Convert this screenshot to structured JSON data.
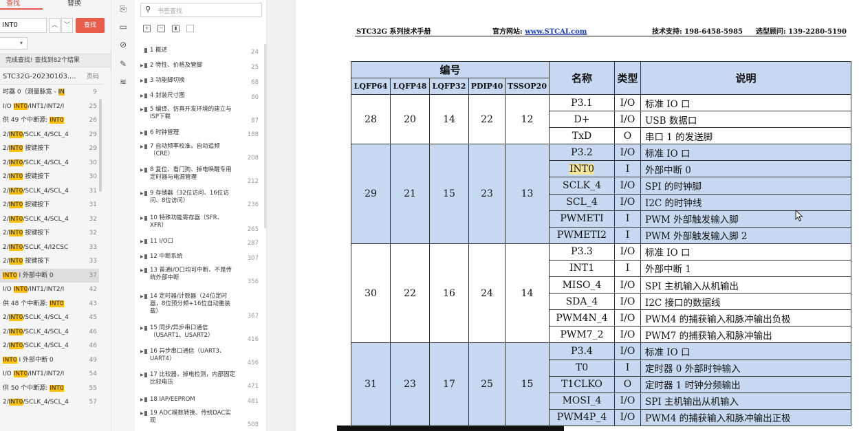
{
  "search_panel": {
    "tabs": [
      "查找",
      "替换"
    ],
    "query": "INT0",
    "find_button": "查找",
    "status": "完成查找! 查找到82个结果",
    "header_title": "STC32G-20230103....",
    "header_page": "页码",
    "results": [
      {
        "pre": "时器 0（测量脉宽 - ",
        "hit": "IN",
        "post": "",
        "page": "9"
      },
      {
        "pre": "I/O ",
        "hit": "INT0",
        "post": "/INT1/INT2/I",
        "page": "25"
      },
      {
        "pre": "供 49 个中断源: ",
        "hit": "INT0",
        "post": "",
        "page": "26"
      },
      {
        "pre": "2/",
        "hit": "INT0",
        "post": "/SCLK_4/SCL_4",
        "page": "29"
      },
      {
        "pre": "2/",
        "hit": "INT0",
        "post": " 按键按下",
        "page": "29"
      },
      {
        "pre": "2/",
        "hit": "INT0",
        "post": "/SCLK_4/SCL_4",
        "page": "30"
      },
      {
        "pre": "2/",
        "hit": "INT0",
        "post": " 按键按下",
        "page": "30"
      },
      {
        "pre": "2/",
        "hit": "INT0",
        "post": "/SCLK_4/SCL_4",
        "page": "31"
      },
      {
        "pre": "2/",
        "hit": "INT0",
        "post": " 按键按下",
        "page": "31"
      },
      {
        "pre": "2/",
        "hit": "INT0",
        "post": "/SCLK_4/SCL_4",
        "page": "32"
      },
      {
        "pre": "2/",
        "hit": "INT0",
        "post": " 按键按下",
        "page": "32"
      },
      {
        "pre": "2/",
        "hit": "INT0",
        "post": "/SCLK_4/I2CSC",
        "page": "33"
      },
      {
        "pre": "2/",
        "hit": "INT0",
        "post": " 按键按下",
        "page": "33"
      },
      {
        "pre": "",
        "hit": "INT0",
        "post": " I 外部中断 0",
        "page": "37"
      },
      {
        "pre": "I/O ",
        "hit": "INT0",
        "post": "/INT1/INT2/I",
        "page": "42"
      },
      {
        "pre": "供 48 个中断源: ",
        "hit": "INT0",
        "post": "",
        "page": "43"
      },
      {
        "pre": "2/",
        "hit": "INT0",
        "post": "/SCLK_4/SCL_4",
        "page": "45"
      },
      {
        "pre": "2/",
        "hit": "INT0",
        "post": "/SCLK_4/SCL_4",
        "page": "46"
      },
      {
        "pre": "2/",
        "hit": "INT0",
        "post": "/SCLK_4/SCL_4",
        "page": "46"
      },
      {
        "pre": "",
        "hit": "INT0",
        "post": " I 外部中断 0",
        "page": "49"
      },
      {
        "pre": "I/O ",
        "hit": "INT0",
        "post": "/INT1/INT2/I",
        "page": "54"
      },
      {
        "pre": "供 50 个中断源: ",
        "hit": "INT0",
        "post": "",
        "page": "55"
      },
      {
        "pre": "2/",
        "hit": "INT0",
        "post": "/SCLK_4/SCL_4",
        "page": "57"
      }
    ]
  },
  "bookmarks": {
    "placeholder": "书签查找",
    "items": [
      {
        "title": "1 概述",
        "page": "24"
      },
      {
        "title": "2 特性、价格及管脚",
        "page": "25"
      },
      {
        "title": "3 功能脚切换",
        "page": "68"
      },
      {
        "title": "4 封装尺寸图",
        "page": "80"
      },
      {
        "title": "5 编译、仿真开发环境的建立与ISP下载",
        "page": "87"
      },
      {
        "title": "6 时钟管理",
        "page": "188"
      },
      {
        "title": "7 自动频率校准，自动追频（CRE）",
        "page": "208"
      },
      {
        "title": "8 复位、看门狗、掉电唤醒专用定时器与电源管理",
        "page": "212"
      },
      {
        "title": "9 存储器（32位访问、16位访问、8位访问）",
        "page": "236"
      },
      {
        "title": "10 特殊功能寄存器（SFR、XFR）",
        "page": "265"
      },
      {
        "title": "11 I/O口",
        "page": "287"
      },
      {
        "title": "12 中断系统",
        "page": "307"
      },
      {
        "title": "13 普通I/O口均可中断、不是传统外部中断",
        "page": "356"
      },
      {
        "title": "14 定时器/计数器（24位定时器，8位预分频+16位自动重装载）",
        "page": "367"
      },
      {
        "title": "15 同步/异步串口通信（USART1、USART2）",
        "page": "416"
      },
      {
        "title": "16 异步串口通信（UART3、UART4）",
        "page": "456"
      },
      {
        "title": "17 比较器，掉电检测，内部固定比较电压",
        "page": "471"
      },
      {
        "title": "18 IAP/EEPROM",
        "page": "481"
      },
      {
        "title": "19 ADC模数转换、传统DAC实现",
        "page": "508"
      }
    ]
  },
  "document": {
    "header_left": "STC32G 系列技术手册",
    "header_site_label": "官方网站: ",
    "header_site_url": "www.STCAI.com",
    "header_support": "技术支持: 198-6458-5985",
    "header_consult": "选型顾问: 139-2280-5190",
    "table": {
      "col_group": "编号",
      "col_name": "名称",
      "col_type": "类型",
      "col_desc": "说明",
      "packages": [
        "LQFP64",
        "LQFP48",
        "LQFP32",
        "PDIP40",
        "TSSOP20"
      ],
      "groups": [
        {
          "nums": [
            "28",
            "20",
            "14",
            "22",
            "12"
          ],
          "blue": false,
          "rows": [
            [
              "P3.1",
              "I/O",
              "标准 IO 口"
            ],
            [
              "D+",
              "I/O",
              "USB 数据口"
            ],
            [
              "TxD",
              "O",
              "串口 1 的发送脚"
            ]
          ]
        },
        {
          "nums": [
            "29",
            "21",
            "15",
            "23",
            "13"
          ],
          "blue": true,
          "rows": [
            [
              "P3.2",
              "I/O",
              "标准 IO 口"
            ],
            [
              "INT0",
              "I",
              "外部中断 0"
            ],
            [
              "SCLK_4",
              "I/O",
              "SPI 的时钟脚"
            ],
            [
              "SCL_4",
              "I/O",
              "I2C 的时钟线"
            ],
            [
              "PWMETI",
              "I",
              "PWM 外部触发输入脚"
            ],
            [
              "PWMETI2",
              "I",
              "PWM 外部触发输入脚 2"
            ]
          ]
        },
        {
          "nums": [
            "30",
            "22",
            "16",
            "24",
            "14"
          ],
          "blue": false,
          "rows": [
            [
              "P3.3",
              "I/O",
              "标准 IO 口"
            ],
            [
              "INT1",
              "I",
              "外部中断 1"
            ],
            [
              "MISO_4",
              "I/O",
              "SPI 主机输入从机输出"
            ],
            [
              "SDA_4",
              "I/O",
              "I2C 接口的数据线"
            ],
            [
              "PWM4N_4",
              "I/O",
              "PWM4 的捕获输入和脉冲输出负极"
            ],
            [
              "PWM7_2",
              "I/O",
              "PWM7 的捕获输入和脉冲输出"
            ]
          ]
        },
        {
          "nums": [
            "31",
            "23",
            "17",
            "25",
            "15"
          ],
          "blue": true,
          "rows": [
            [
              "P3.4",
              "I/O",
              "标准 IO 口"
            ],
            [
              "T0",
              "I",
              "定时器 0 外部时钟输入"
            ],
            [
              "T1CLKO",
              "O",
              "定时器 1 时钟分频输出"
            ],
            [
              "MOSI_4",
              "I/O",
              "SPI 主机输出从机输入"
            ],
            [
              "PWM4P_4",
              "I/O",
              "PWM4 的捕获输入和脉冲输出正极"
            ]
          ]
        }
      ]
    }
  }
}
